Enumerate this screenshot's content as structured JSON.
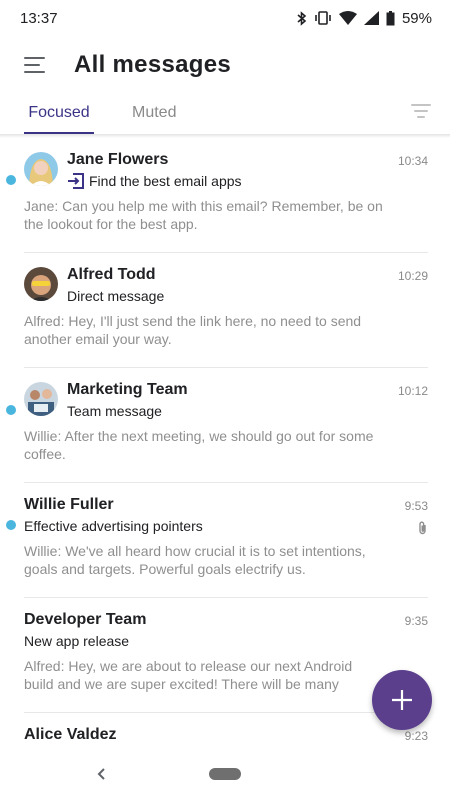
{
  "status_bar": {
    "time": "13:37",
    "battery_percent": "59%",
    "icons": [
      "bluetooth-icon",
      "vibrate-icon",
      "wifi-icon",
      "cellular-signal-icon",
      "battery-icon"
    ]
  },
  "header": {
    "title": "All messages",
    "menu_icon": "hamburger-menu-icon"
  },
  "tabs": [
    {
      "label": "Focused",
      "selected": true
    },
    {
      "label": "Muted",
      "selected": false
    }
  ],
  "filter_icon": "filter-icon",
  "messages": [
    {
      "sender": "Jane Flowers",
      "subject": "Find the best email apps",
      "time": "10:34",
      "preview": "Jane: Can you help me with this email? Remember, be on the lookout for the best app.",
      "unread": true,
      "has_avatar": true,
      "subject_icon": "forward-inbox-icon"
    },
    {
      "sender": "Alfred Todd",
      "subject": "Direct message",
      "time": "10:29",
      "preview": "Alfred: Hey, I'll just send the link here, no need to send another email your way.",
      "unread": false,
      "has_avatar": true
    },
    {
      "sender": "Marketing Team",
      "subject": "Team message",
      "time": "10:12",
      "preview": "Willie: After the next meeting, we should go out for some coffee.",
      "unread": true,
      "has_avatar": true
    },
    {
      "sender": "Willie Fuller",
      "subject": "Effective advertising pointers",
      "time": "9:53",
      "preview": "Willie: We've all heard how crucial it is to set intentions, goals and targets. Powerful goals electrify us.",
      "unread": true,
      "has_avatar": false,
      "attachment_icon": "paperclip-icon"
    },
    {
      "sender": "Developer Team",
      "subject": "New app release",
      "time": "9:35",
      "preview": "Alfred: Hey, we are about to release our next Android build and we are super excited! There will be many",
      "unread": false,
      "has_avatar": false
    },
    {
      "sender": "Alice Valdez",
      "subject": "",
      "time": "9:23",
      "preview": "",
      "unread": false,
      "has_avatar": false
    }
  ],
  "fab_icon": "plus-icon",
  "colors": {
    "accent": "#3b3486",
    "fab": "#5b3f8c",
    "unread_dot": "#4ab6de"
  }
}
